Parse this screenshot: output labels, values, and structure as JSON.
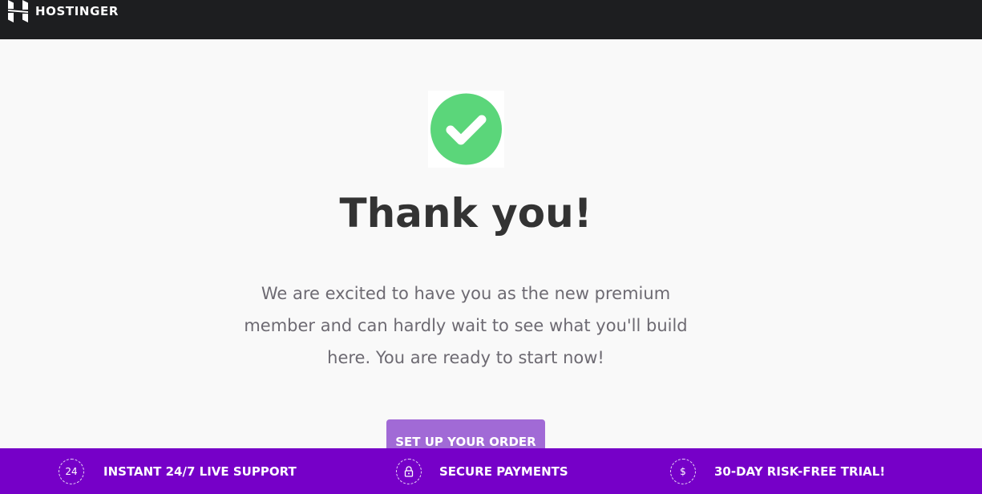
{
  "header": {
    "brand": "HOSTINGER",
    "logo_icon": "hostinger-logo-icon"
  },
  "main": {
    "success_icon": "checkmark-circle-icon",
    "success_color": "#5bd67a",
    "title": "Thank you!",
    "message": "We are excited to have you as the new premium member and can hardly wait to see what you'll build here. You are ready to start now!",
    "cta_label": "SET UP YOUR ORDER",
    "cta_color": "#a16ad6"
  },
  "footer": {
    "background": "#7600c8",
    "features": [
      {
        "icon": "support-24-icon",
        "icon_text": "24",
        "label": "INSTANT 24/7 LIVE SUPPORT"
      },
      {
        "icon": "lock-icon",
        "label": "SECURE PAYMENTS"
      },
      {
        "icon": "dollar-icon",
        "icon_text": "$",
        "label": "30-DAY RISK-FREE TRIAL!"
      }
    ]
  }
}
